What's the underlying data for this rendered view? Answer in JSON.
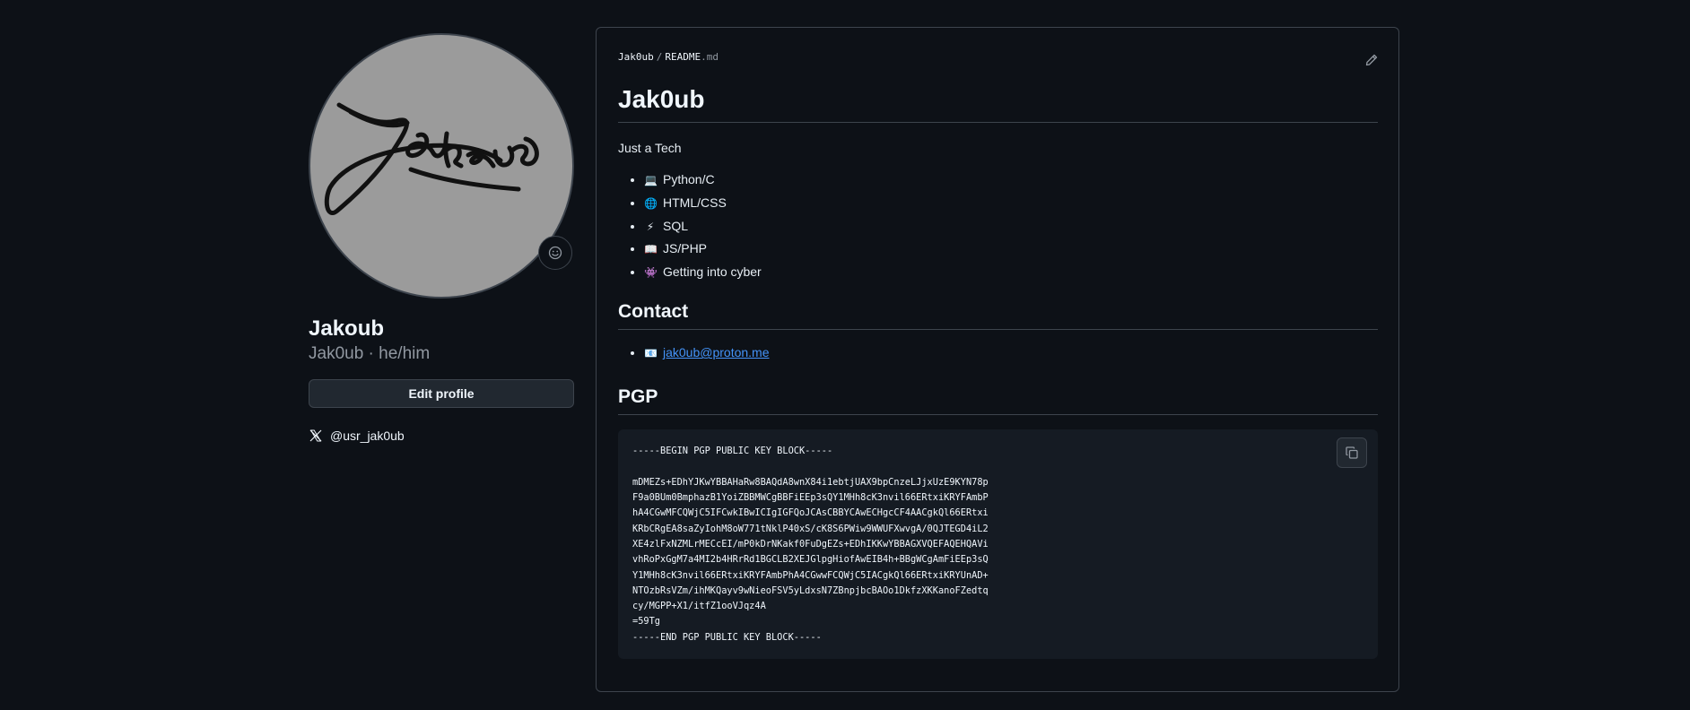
{
  "profile": {
    "display_name": "Jakoub",
    "login_pronouns": "Jak0ub · he/him",
    "edit_button": "Edit profile",
    "social_handle": "@usr_jak0ub",
    "avatar_icon": "signature-avatar",
    "status_icon": "smiley-icon"
  },
  "readme": {
    "breadcrumb": {
      "owner": "Jak0ub",
      "separator": "/",
      "file": "README",
      "ext": ".md"
    },
    "title": "Jak0ub",
    "tagline": "Just a Tech",
    "skills": [
      {
        "emoji": "💻",
        "label": "Python/C"
      },
      {
        "emoji": "🌐",
        "label": "HTML/CSS"
      },
      {
        "emoji": "⚡",
        "label": "SQL"
      },
      {
        "emoji": "📖",
        "label": "JS/PHP"
      },
      {
        "emoji": "👾",
        "label": "Getting into cyber"
      }
    ],
    "contact_heading": "Contact",
    "contact": {
      "emoji": "📧",
      "email": "jak0ub@proton.me"
    },
    "pgp_heading": "PGP",
    "pgp_block": "-----BEGIN PGP PUBLIC KEY BLOCK-----\n\nmDMEZs+EDhYJKwYBBAHaRw8BAQdA8wnX84i1ebtjUAX9bpCnzeLJjxUzE9KYN78p\nF9a0BUm0BmphazB1YoiZBBMWCgBBFiEEp3sQY1MHh8cK3nvil66ERtxiKRYFAmbP\nhA4CGwMFCQWjC5IFCwkIBwICIgIGFQoJCAsCBBYCAwECHgcCF4AACgkQl66ERtxi\nKRbCRgEA8saZyIohM8oW771tNklP40xS/cK8S6PWiw9WWUFXwvgA/0QJTEGD4iL2\nXE4zlFxNZMLrMECcEI/mP0kDrNKakf0FuDgEZs+EDhIKKwYBBAGXVQEFAQEHQAVi\nvhRoPxGgM7a4MI2b4HRrRd1BGCLB2XEJGlpgHiofAwEIB4h+BBgWCgAmFiEEp3sQ\nY1MHh8cK3nvil66ERtxiKRYFAmbPhA4CGwwFCQWjC5IACgkQl66ERtxiKRYUnAD+\nNTOzbRsVZm/ihMKQayv9wNieoFSV5yLdxsN7ZBnpjbcBAOo1DkfzXKKanoFZedtq\ncy/MGPP+X1/itfZ1ooVJqz4A\n=59Tg\n-----END PGP PUBLIC KEY BLOCK-----",
    "edit_icon": "pencil-icon",
    "copy_icon": "copy-icon"
  },
  "colors": {
    "background": "#0d1117",
    "border": "#3d444d",
    "link": "#4493f8",
    "code_bg": "#151b23",
    "muted": "#9198a1"
  }
}
